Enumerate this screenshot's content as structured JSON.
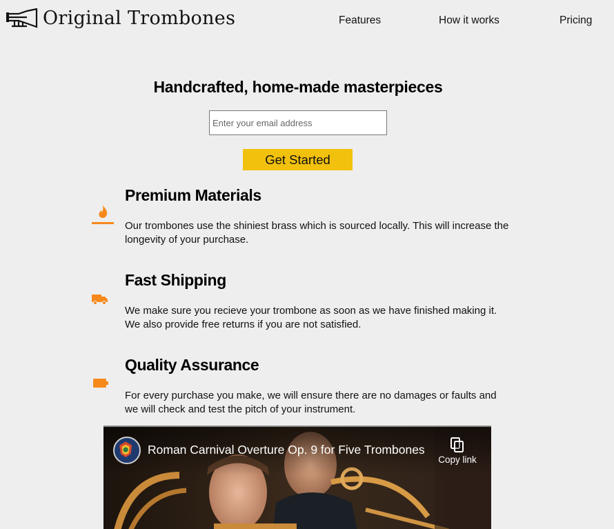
{
  "header": {
    "brand": "Original Trombones",
    "nav": [
      {
        "label": "Features"
      },
      {
        "label": "How it works"
      },
      {
        "label": "Pricing"
      }
    ]
  },
  "hero": {
    "title": "Handcrafted, home-made masterpieces",
    "email_placeholder": "Enter your email address",
    "cta_label": "Get Started"
  },
  "features": [
    {
      "icon": "fire-icon",
      "title": "Premium Materials",
      "text": "Our trombones use the shiniest brass which is sourced locally. This will increase the longevity of your purchase."
    },
    {
      "icon": "truck-icon",
      "title": "Fast Shipping",
      "text": "We make sure you recieve your trombone as soon as we have finished making it. We also provide free returns if you are not satisfied."
    },
    {
      "icon": "battery-icon",
      "title": "Quality Assurance",
      "text": "For every purchase you make, we will ensure there are no damages or faults and we will check and test the pitch of your instrument."
    }
  ],
  "video": {
    "title": "Roman Carnival Overture Op. 9 for Five Trombones",
    "copy_link_label": "Copy link"
  },
  "colors": {
    "accent": "#f2c10d",
    "icon": "#f7891b",
    "background": "#eeeeee"
  }
}
